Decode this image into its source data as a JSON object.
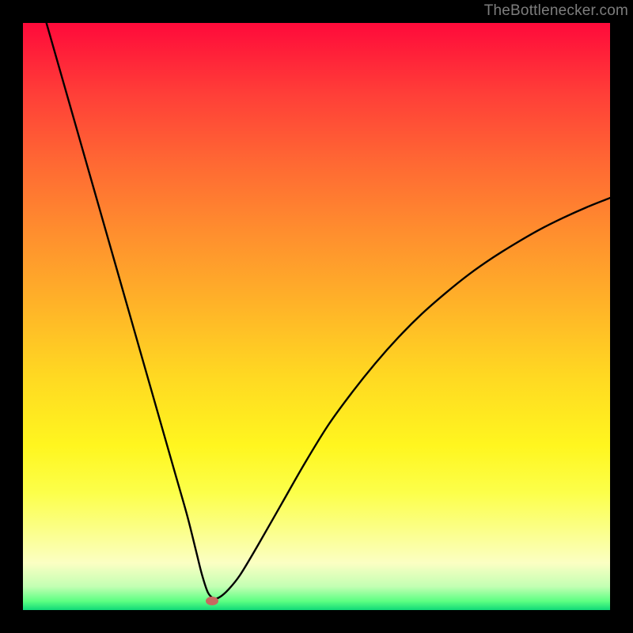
{
  "watermark": "TheBottlenecker.com",
  "chart_data": {
    "type": "line",
    "title": "",
    "xlabel": "",
    "ylabel": "",
    "xlim": [
      0,
      100
    ],
    "ylim": [
      0,
      100
    ],
    "grid": false,
    "series": [
      {
        "name": "bottleneck-curve",
        "x": [
          4,
          6,
          8,
          10,
          12,
          14,
          16,
          18,
          20,
          22,
          24,
          26,
          28,
          29.5,
          30.5,
          31.5,
          32.5,
          33.5,
          35,
          37,
          40,
          44,
          48,
          52,
          56,
          60,
          64,
          68,
          72,
          76,
          80,
          84,
          88,
          92,
          96,
          100
        ],
        "y": [
          100,
          93,
          86,
          79,
          72,
          65,
          58,
          51,
          44,
          37,
          30,
          23,
          16,
          10,
          6,
          3,
          2,
          2.2,
          3.5,
          6,
          11,
          18,
          25,
          31.5,
          37,
          42,
          46.5,
          50.5,
          54,
          57.2,
          60,
          62.5,
          64.8,
          66.8,
          68.6,
          70.2
        ]
      }
    ],
    "marker": {
      "x": 32.2,
      "y": 1.6
    },
    "gradient_stops": [
      {
        "pos": 0,
        "color": "#ff0a3a"
      },
      {
        "pos": 0.12,
        "color": "#ff3e38"
      },
      {
        "pos": 0.24,
        "color": "#ff6933"
      },
      {
        "pos": 0.36,
        "color": "#ff8f2e"
      },
      {
        "pos": 0.48,
        "color": "#ffb328"
      },
      {
        "pos": 0.6,
        "color": "#ffd822"
      },
      {
        "pos": 0.72,
        "color": "#fff61f"
      },
      {
        "pos": 0.8,
        "color": "#fcff4a"
      },
      {
        "pos": 0.86,
        "color": "#fbff85"
      },
      {
        "pos": 0.92,
        "color": "#fbffc3"
      },
      {
        "pos": 0.96,
        "color": "#c3ffb3"
      },
      {
        "pos": 0.985,
        "color": "#5cff82"
      },
      {
        "pos": 1.0,
        "color": "#10d978"
      }
    ]
  }
}
